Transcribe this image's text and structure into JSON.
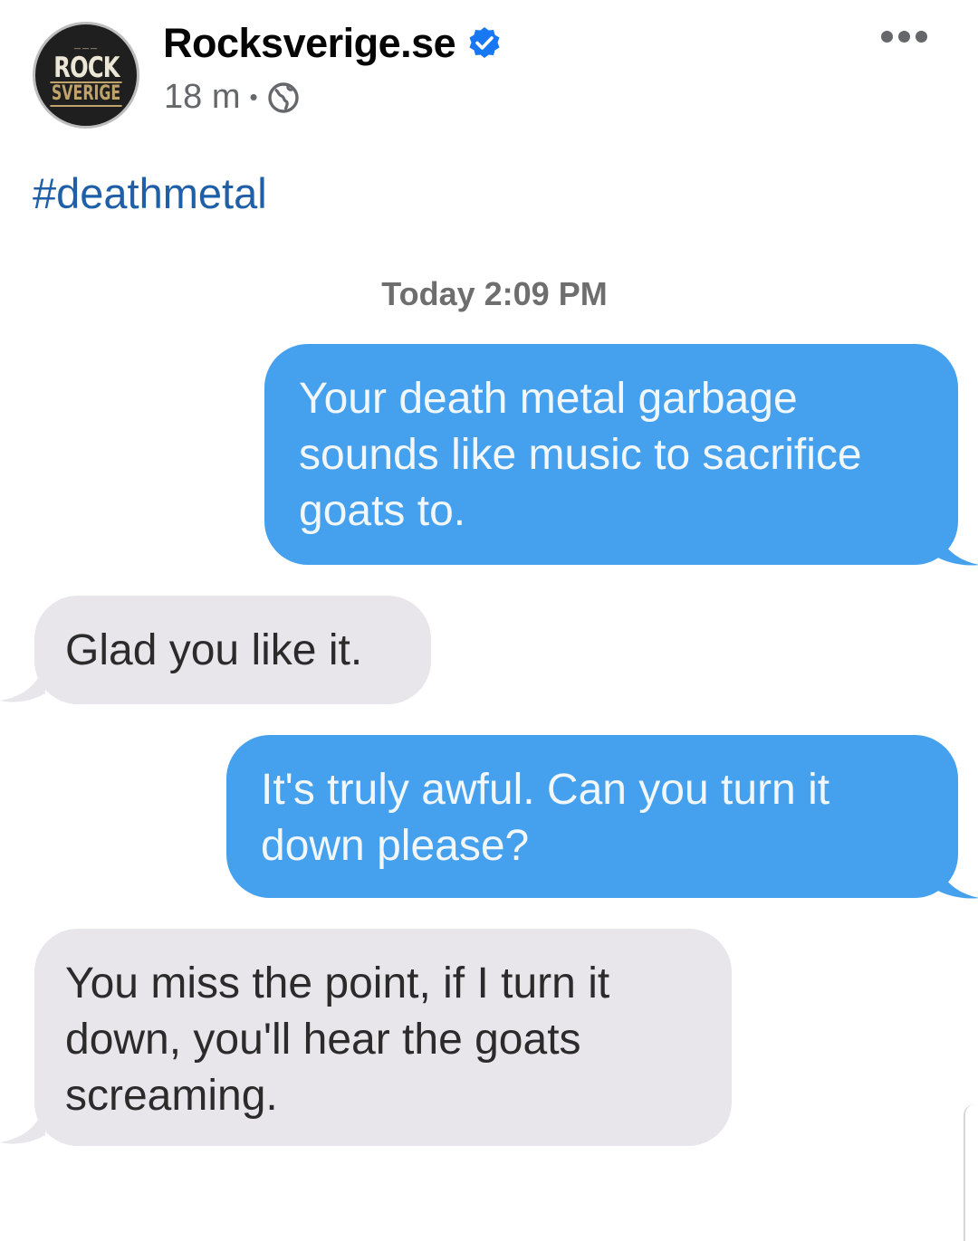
{
  "post": {
    "page_name": "Rocksverige.se",
    "time": "18 m",
    "separator": "•",
    "hashtag": "#deathmetal",
    "icons": {
      "verified": "verified-badge-icon",
      "privacy": "globe-icon",
      "more": "more-options-icon"
    },
    "avatar": {
      "line1": "ROCK",
      "line2": "SVERIGE"
    }
  },
  "conversation": {
    "timestamp": "Today 2:09 PM",
    "messages": [
      {
        "from": "sent",
        "text": "Your death metal garbage sounds like music to sacrifice goats to."
      },
      {
        "from": "received",
        "text": "Glad you like it."
      },
      {
        "from": "sent",
        "text": "It's truly awful. Can you turn it down please?"
      },
      {
        "from": "received",
        "text": "You miss the point, if I turn it down, you'll hear the goats screaming."
      }
    ]
  },
  "colors": {
    "sent_bubble": "#45a1ee",
    "received_bubble": "#e8e6ea",
    "hashtag": "#1f5fa8",
    "verified": "#1877f2",
    "meta_text": "#65676b"
  }
}
